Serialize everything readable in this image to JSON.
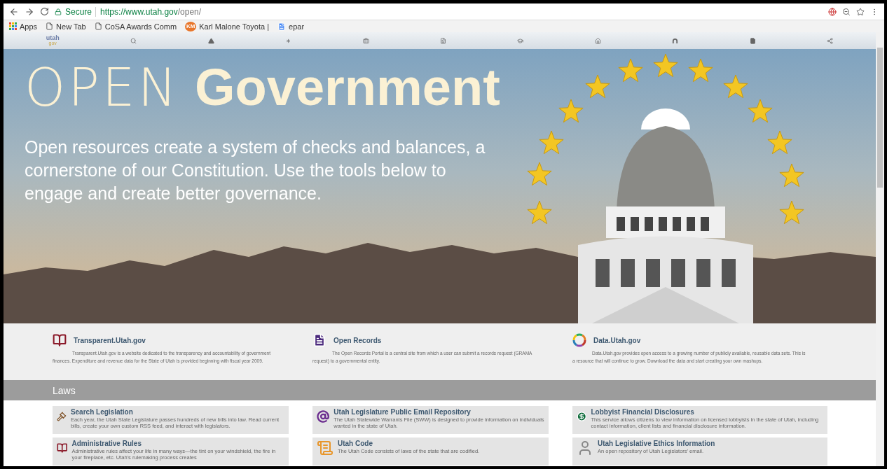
{
  "browser": {
    "secure_label": "Secure",
    "url_host": "https://www.utah.gov",
    "url_path": "/open/"
  },
  "bookmarks": [
    {
      "kind": "apps",
      "label": "Apps"
    },
    {
      "kind": "page",
      "label": "New Tab"
    },
    {
      "kind": "page",
      "label": "CoSA Awards Comm"
    },
    {
      "kind": "favicon",
      "label": "Karl Malone Toyota |",
      "badge": "KM"
    },
    {
      "kind": "doc",
      "label": "epar"
    }
  ],
  "site_nav": {
    "logo_top": "utah",
    "logo_bottom": "gov",
    "items": [
      {
        "kind": "search"
      },
      {
        "kind": "triangle"
      },
      {
        "kind": "asterisk"
      },
      {
        "kind": "briefcase"
      },
      {
        "kind": "document"
      },
      {
        "kind": "cap"
      },
      {
        "kind": "home"
      },
      {
        "kind": "arch"
      },
      {
        "kind": "file"
      },
      {
        "kind": "share"
      }
    ]
  },
  "hero": {
    "title_light": "OPEN",
    "title_bold": "Government",
    "subtitle": "Open resources create a system of checks and balances, a cornerstone of our Constitution. Use the tools below to engage and create better governance."
  },
  "features": [
    {
      "kind": "book",
      "title": "Transparent.Utah.gov",
      "text": "Transparent.Utah.gov is a website dedicated to the transparency and accountability of government finances. Expenditure and revenue data for the State of Utah is provided beginning with fiscal year 2009."
    },
    {
      "kind": "document",
      "title": "Open Records",
      "text": "The Open Records Portal is a central site from which a user can submit a records request (GRAMA request) to a governmental entity."
    },
    {
      "kind": "ring",
      "title": "Data.Utah.gov",
      "text": "Data.Utah.gov provides open access to a growing number of publicly available, reusable data sets. This is a resource that will continue to grow. Download the data and start creating your own mashups."
    }
  ],
  "section": {
    "title": "Laws"
  },
  "cards": [
    {
      "kind": "gavel",
      "title": "Search Legislation",
      "text": "Each year, the Utah State Legislature passes hundreds of new bills into law. Read current bills, create your own custom RSS feed, and interact with legislators."
    },
    {
      "kind": "at",
      "title": "Utah Legislature Public Email Repository",
      "text": "The Utah Statewide Warrants File (SWW) is designed to provide information on individuals wanted in the state of Utah."
    },
    {
      "kind": "dollar",
      "title": "Lobbyist Financial Disclosures",
      "text": "This service allows citizens to view information on licensed lobbyists in the state of Utah, including contact information, client lists and financial disclosure information."
    },
    {
      "kind": "book",
      "title": "Administrative Rules",
      "text": "Administrative rules affect your life in many ways—the tint on your windshield, the fire in your fireplace, etc. Utah's rulemaking process creates"
    },
    {
      "kind": "scroll",
      "title": "Utah Code",
      "text": "The Utah Code consists of laws of the state that are codified."
    },
    {
      "kind": "person",
      "title": "Utah Legislative Ethics Information",
      "text": "An open repository of Utah Legislators' email."
    }
  ]
}
